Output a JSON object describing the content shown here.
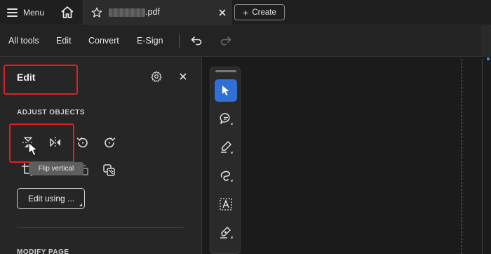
{
  "tabbar": {
    "menu_label": "Menu",
    "file_suffix": ".pdf",
    "create_label": "Create"
  },
  "toolbar": {
    "items": [
      "All tools",
      "Edit",
      "Convert",
      "E-Sign"
    ]
  },
  "panel": {
    "title": "Edit",
    "section_adjust": "ADJUST OBJECTS",
    "tooltip": "Flip vertical",
    "edit_using": "Edit using ...",
    "section_modify": "MODIFY PAGE"
  },
  "colors": {
    "highlight": "#e02020",
    "active_tool": "#2f6fd6"
  },
  "icons": {
    "tools": [
      "select-pointer-icon",
      "comment-icon",
      "highlight-pen-icon",
      "draw-lasso-icon",
      "text-select-icon",
      "signature-pen-icon"
    ]
  }
}
